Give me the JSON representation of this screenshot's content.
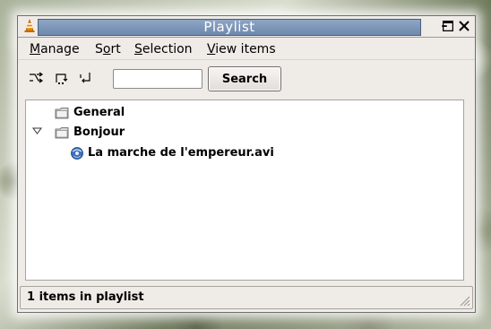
{
  "window": {
    "title": "Playlist"
  },
  "controls": {
    "minimize": "–",
    "maximize": "☐",
    "close": "✕"
  },
  "menu": [
    {
      "label": "Manage",
      "mnemonic": "M",
      "rest": "anage"
    },
    {
      "label": "Sort",
      "pre": "S",
      "mnemonic": "o",
      "rest": "rt"
    },
    {
      "label": "Selection",
      "mnemonic": "S",
      "rest": "election"
    },
    {
      "label": "View items",
      "mnemonic": "V",
      "rest": "iew items"
    }
  ],
  "toolbar": {
    "icons": [
      "shuffle-icon",
      "repeat-all-icon",
      "repeat-one-icon"
    ],
    "search_value": "",
    "search_label": "Search"
  },
  "tree": [
    {
      "label": "General",
      "type": "folder",
      "expanded": false
    },
    {
      "label": "Bonjour",
      "type": "folder",
      "expanded": true
    },
    {
      "label": "La marche de l'empereur.avi",
      "type": "item"
    }
  ],
  "status": {
    "text": "1 items in playlist"
  },
  "colors": {
    "titlebar_accent": "#7b94b6",
    "window_bg": "#efebe7"
  }
}
